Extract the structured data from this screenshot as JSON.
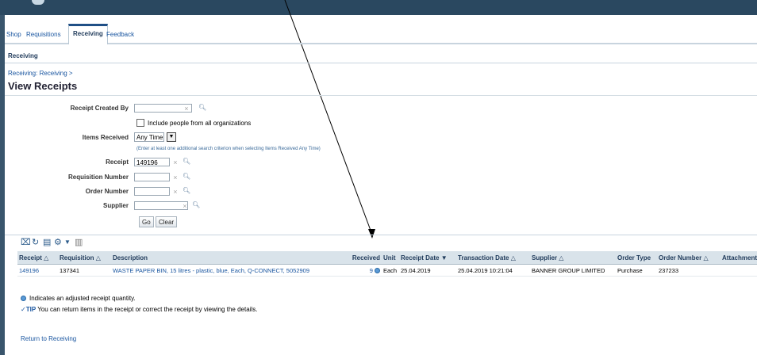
{
  "tabs": [
    "Shop",
    "Requisitions",
    "Receiving",
    "Feedback"
  ],
  "subtab": "Receiving",
  "breadcrumb": "Receiving: Receiving >",
  "page_title": "View Receipts",
  "form": {
    "receipt_created_by": {
      "label": "Receipt Created By",
      "value": ""
    },
    "include_people_label": "Include people from all organizations",
    "items_received": {
      "label": "Items Received",
      "value": "Any Time"
    },
    "hint": "(Enter at least one additional search criterion when selecting Items Received Any Time)",
    "receipt": {
      "label": "Receipt",
      "value": "149196"
    },
    "requisition_number": {
      "label": "Requisition Number",
      "value": ""
    },
    "order_number": {
      "label": "Order Number",
      "value": ""
    },
    "supplier": {
      "label": "Supplier",
      "value": ""
    },
    "go_label": "Go",
    "clear_label": "Clear"
  },
  "table": {
    "headers": [
      "Receipt",
      "Requisition",
      "Description",
      "Received",
      "Unit",
      "Receipt Date",
      "Transaction Date",
      "Supplier",
      "Order Type",
      "Order Number",
      "Attachments"
    ],
    "sort_markers": {
      "receipt": "△",
      "requisition": "△",
      "receipt_date": "▼",
      "transaction_date": "△",
      "supplier": "△",
      "order_number": "△"
    },
    "rows": [
      {
        "receipt": "149196",
        "requisition": "137341",
        "description": "WASTE PAPER BIN, 15 litres - plastic, blue, Each, Q-CONNECT, 5052909",
        "received": "9",
        "unit": "Each",
        "receipt_date": "25.04.2019",
        "transaction_date": "25.04.2019 10:21:04",
        "supplier": "BANNER GROUP LIMITED",
        "order_type": "Purchase",
        "order_number": "237233",
        "attachments": ""
      }
    ]
  },
  "notes": {
    "adjusted": "Indicates an adjusted receipt quantity.",
    "tip_label": "TIP",
    "tip_text": "You can return items in the receipt or correct the receipt by viewing the details."
  },
  "return_link": "Return to Receiving",
  "icons": [
    "detach-icon",
    "refresh-icon",
    "export-icon",
    "settings-icon",
    "dropdown-icon",
    "columns-icon",
    "clear-icon",
    "search-icon",
    "info-icon",
    "tip-icon"
  ],
  "colors": {
    "topbar": "#2a4860",
    "link": "#1a56a0",
    "table_header": "#d9e3ea"
  }
}
